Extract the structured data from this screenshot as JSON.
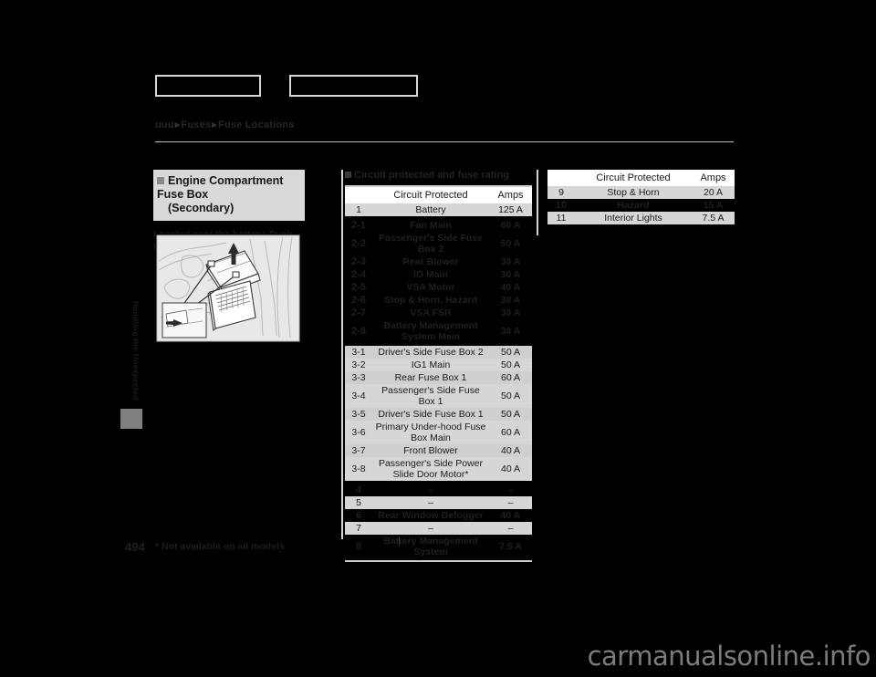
{
  "top_tabs": [
    {
      "label": ""
    },
    {
      "label": ""
    }
  ],
  "breadcrumb": {
    "root": "uuu",
    "mid": "Fuses",
    "leaf": "Fuse Locations"
  },
  "left_panel": {
    "title_line1": "Engine Compartment Fuse Box",
    "title_line2": "(Secondary)",
    "body": "Located near the battery. Push the tabs to open the box.",
    "figure_caption": ""
  },
  "side_tab": {
    "label": "Handling the Unexpected"
  },
  "mid_table": {
    "heading": "Circuit protected and fuse rating",
    "columns": [
      "",
      "Circuit Protected",
      "Amps"
    ],
    "rows": [
      {
        "id": "1",
        "name": "Battery",
        "amps": "125 A",
        "style": "light"
      },
      {
        "id": "2-1",
        "name": "Fan Main",
        "amps": "60 A",
        "style": "dark"
      },
      {
        "id": "2-2",
        "name": "Passenger's Side Fuse Box 2",
        "amps": "50 A",
        "style": "dark"
      },
      {
        "id": "2-3",
        "name": "Rear Blower",
        "amps": "30 A",
        "style": "dark"
      },
      {
        "id": "2-4",
        "name": "IG Main",
        "amps": "30 A",
        "style": "dark"
      },
      {
        "id": "2-5",
        "name": "VSA Motor",
        "amps": "40 A",
        "style": "dark"
      },
      {
        "id": "2-6",
        "name": "Stop & Horn, Hazard",
        "amps": "30 A",
        "style": "dark"
      },
      {
        "id": "2-7",
        "name": "VSA FSR",
        "amps": "30 A",
        "style": "dark"
      },
      {
        "id": "2-8",
        "name": "Battery Management System Main",
        "amps": "30 A",
        "style": "dark"
      },
      {
        "id": "3-1",
        "name": "Driver's Side Fuse Box 2",
        "amps": "50 A",
        "style": "light"
      },
      {
        "id": "3-2",
        "name": "IG1 Main",
        "amps": "50 A",
        "style": "light"
      },
      {
        "id": "3-3",
        "name": "Rear Fuse Box 1",
        "amps": "60 A",
        "style": "light"
      },
      {
        "id": "3-4",
        "name": "Passenger's Side Fuse Box 1",
        "amps": "50 A",
        "style": "light"
      },
      {
        "id": "3-5",
        "name": "Driver's Side Fuse Box 1",
        "amps": "50 A",
        "style": "light"
      },
      {
        "id": "3-6",
        "name": "Primary Under-hood Fuse Box Main",
        "amps": "60 A",
        "style": "light"
      },
      {
        "id": "3-7",
        "name": "Front Blower",
        "amps": "40 A",
        "style": "light"
      },
      {
        "id": "3-8",
        "name": "Passenger's Side Power Slide Door Motor*",
        "amps": "40 A",
        "style": "light"
      },
      {
        "id": "4",
        "name": "–",
        "amps": "–",
        "style": "dark"
      },
      {
        "id": "5",
        "name": "–",
        "amps": "–",
        "style": "light"
      },
      {
        "id": "6",
        "name": "Rear Window Defogger",
        "amps": "40 A",
        "style": "dark"
      },
      {
        "id": "7",
        "name": "–",
        "amps": "–",
        "style": "light"
      },
      {
        "id": "8",
        "name": "Battery Management System",
        "amps": "7.5 A",
        "style": "dark"
      }
    ]
  },
  "right_table": {
    "columns": [
      "",
      "Circuit Protected",
      "Amps"
    ],
    "rows": [
      {
        "id": "9",
        "name": "Stop & Horn",
        "amps": "20 A",
        "style": "light"
      },
      {
        "id": "10",
        "name": "Hazard",
        "amps": "15 A",
        "style": "dark"
      },
      {
        "id": "11",
        "name": "Interior Lights",
        "amps": "7.5 A",
        "style": "light"
      }
    ]
  },
  "footer": {
    "page_number": "494",
    "footnote": "* Not available on all models"
  },
  "watermark": "carmanualsonline.info"
}
